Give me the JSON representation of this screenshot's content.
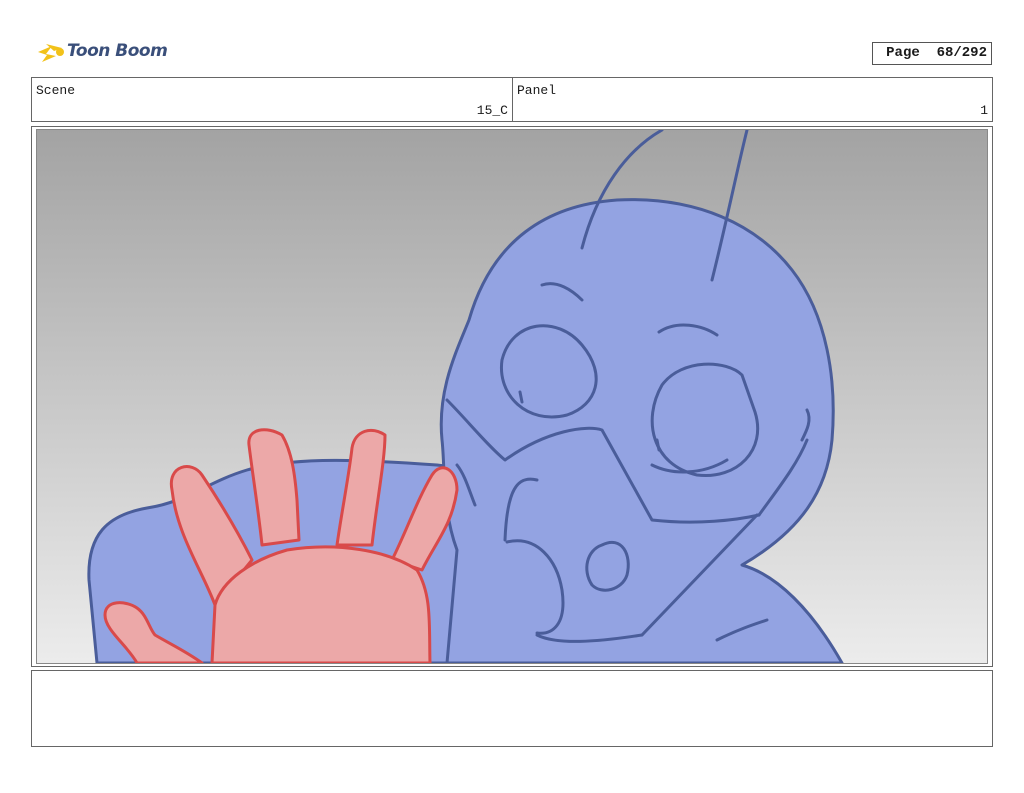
{
  "header": {
    "logo_text": "Toon Boom",
    "page_label": "Page",
    "page_number": "68/292"
  },
  "scene": {
    "label": "Scene",
    "value": "15_C"
  },
  "panel": {
    "label": "Panel",
    "value": "1"
  },
  "colors": {
    "sky_top": "#a3a3a3",
    "sky_bottom": "#ececec",
    "character_fill": "#93a3e2",
    "character_line": "#4a5d9a",
    "hand_fill": "#eca8a8",
    "hand_line": "#d94a4a"
  },
  "notes": {
    "text": ""
  }
}
